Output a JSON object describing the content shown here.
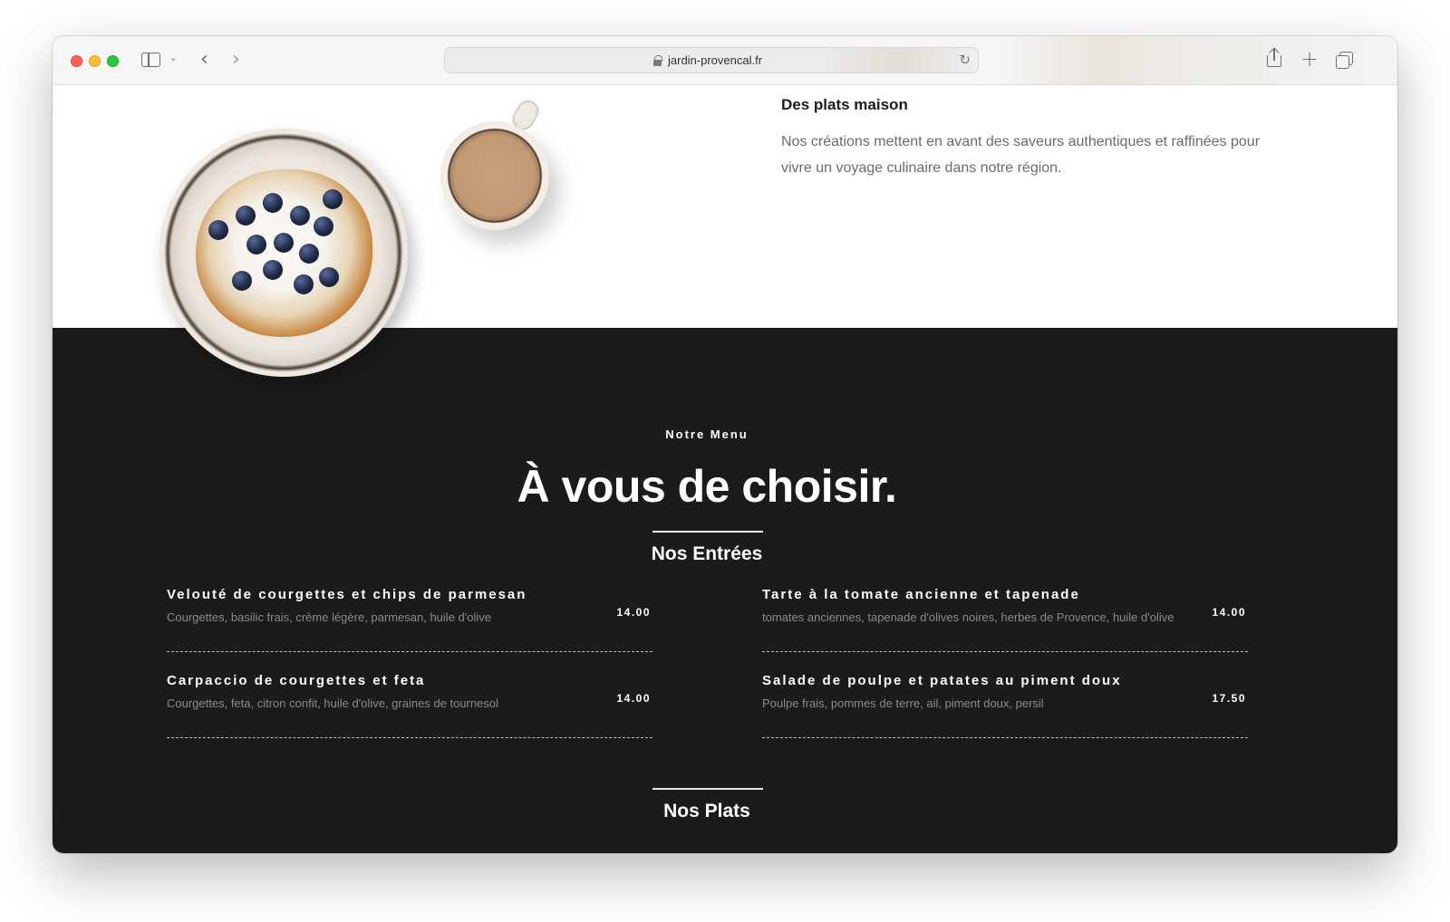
{
  "browser": {
    "url": "jardin-provencal.fr"
  },
  "intro": {
    "title": "Des plats maison",
    "text": "Nos créations mettent en avant des saveurs authentiques et raffinées pour vivre un voyage culinaire dans notre région."
  },
  "menu": {
    "eyebrow": "Notre Menu",
    "headline": "À vous de choisir.",
    "starters_title": "Nos Entrées",
    "mains_title": "Nos Plats",
    "starters": [
      {
        "name": "Velouté de courgettes et chips de parmesan",
        "description": "Courgettes, basilic frais, crème légère, parmesan, huile d'olive",
        "price": "14.00"
      },
      {
        "name": "Tarte à la tomate ancienne et tapenade",
        "description": "tomates anciennes, tapenade d'olives noires, herbes de Provence, huile d'olive",
        "price": "14.00"
      },
      {
        "name": "Carpaccio de courgettes et feta",
        "description": "Courgettes, feta, citron confit, huile d'olive, graines de tournesol",
        "price": "14.00"
      },
      {
        "name": "Salade de poulpe et patates au piment doux",
        "description": "Poulpe frais, pommes de terre, ail, piment doux, persil",
        "price": "17.50"
      }
    ]
  }
}
